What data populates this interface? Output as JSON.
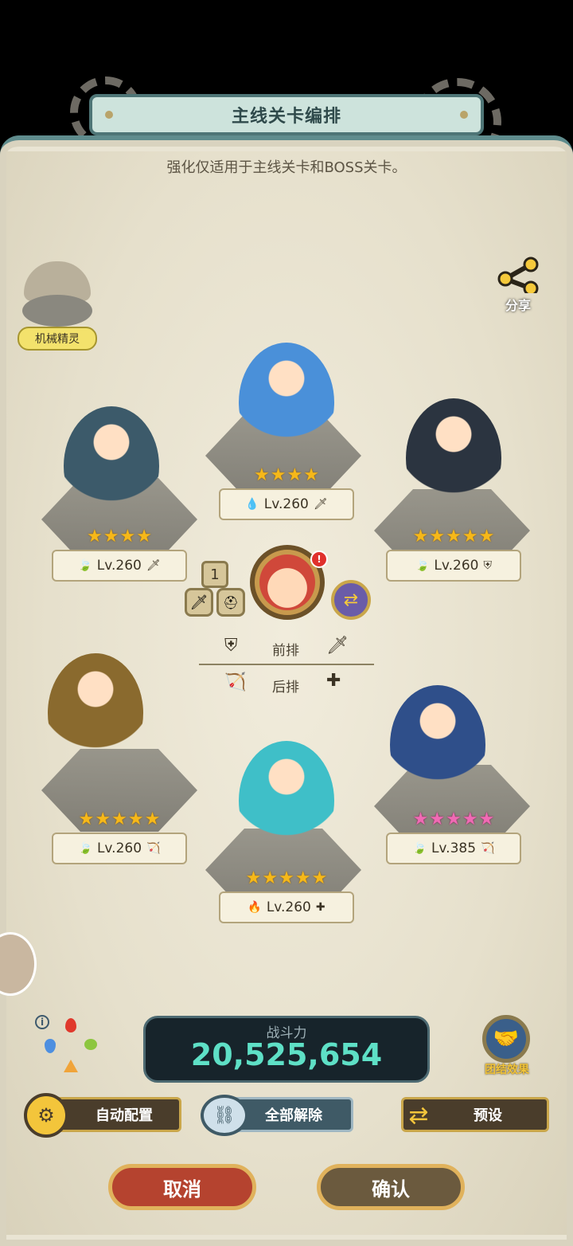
{
  "header": {
    "title": "主线关卡编排",
    "subtitle": "强化仅适用于主线关卡和BOSS关卡。"
  },
  "spirit": {
    "label": "机械精灵"
  },
  "share": {
    "label": "分享"
  },
  "heroes": [
    {
      "slot": "top-center",
      "stars": 4,
      "star_color": "gold",
      "element": "water-icon",
      "level": "Lv.260",
      "role": "sword-icon",
      "color": "#4a90d9"
    },
    {
      "slot": "front-left",
      "stars": 4,
      "star_color": "gold",
      "element": "wind-icon",
      "level": "Lv.260",
      "role": "sword-icon",
      "color": "#3c5a6a"
    },
    {
      "slot": "front-right",
      "stars": 5,
      "star_color": "gold",
      "element": "wind-icon",
      "level": "Lv.260",
      "role": "shield-icon",
      "color": "#2b3440"
    },
    {
      "slot": "back-left",
      "stars": 5,
      "star_color": "gold",
      "element": "wind-icon",
      "level": "Lv.260",
      "role": "bow-icon",
      "color": "#8a6a2e"
    },
    {
      "slot": "back-center",
      "stars": 5,
      "star_color": "gold",
      "element": "fire-icon",
      "level": "Lv.260",
      "role": "healer-icon",
      "color": "#3fbfc8"
    },
    {
      "slot": "back-right",
      "stars": 5,
      "star_color": "pink",
      "element": "wind-icon",
      "level": "Lv.385",
      "role": "bow-icon",
      "color": "#2f4f8a"
    }
  ],
  "leader": {
    "slot_number": "1",
    "badge": "!"
  },
  "formation": {
    "front_label": "前排",
    "back_label": "后排"
  },
  "power": {
    "label": "战斗力",
    "value": "20,525,654"
  },
  "team_effect": {
    "label": "团结效果"
  },
  "buttons": {
    "auto": "自动配置",
    "clear": "全部解除",
    "preset": "预设",
    "cancel": "取消",
    "confirm": "确认"
  },
  "colors": {
    "panel": "#e9e4d3",
    "teal": "#4e7576",
    "power_value": "#5ee0c6",
    "cancel": "#b5432f",
    "confirm": "#6b5a3e"
  }
}
